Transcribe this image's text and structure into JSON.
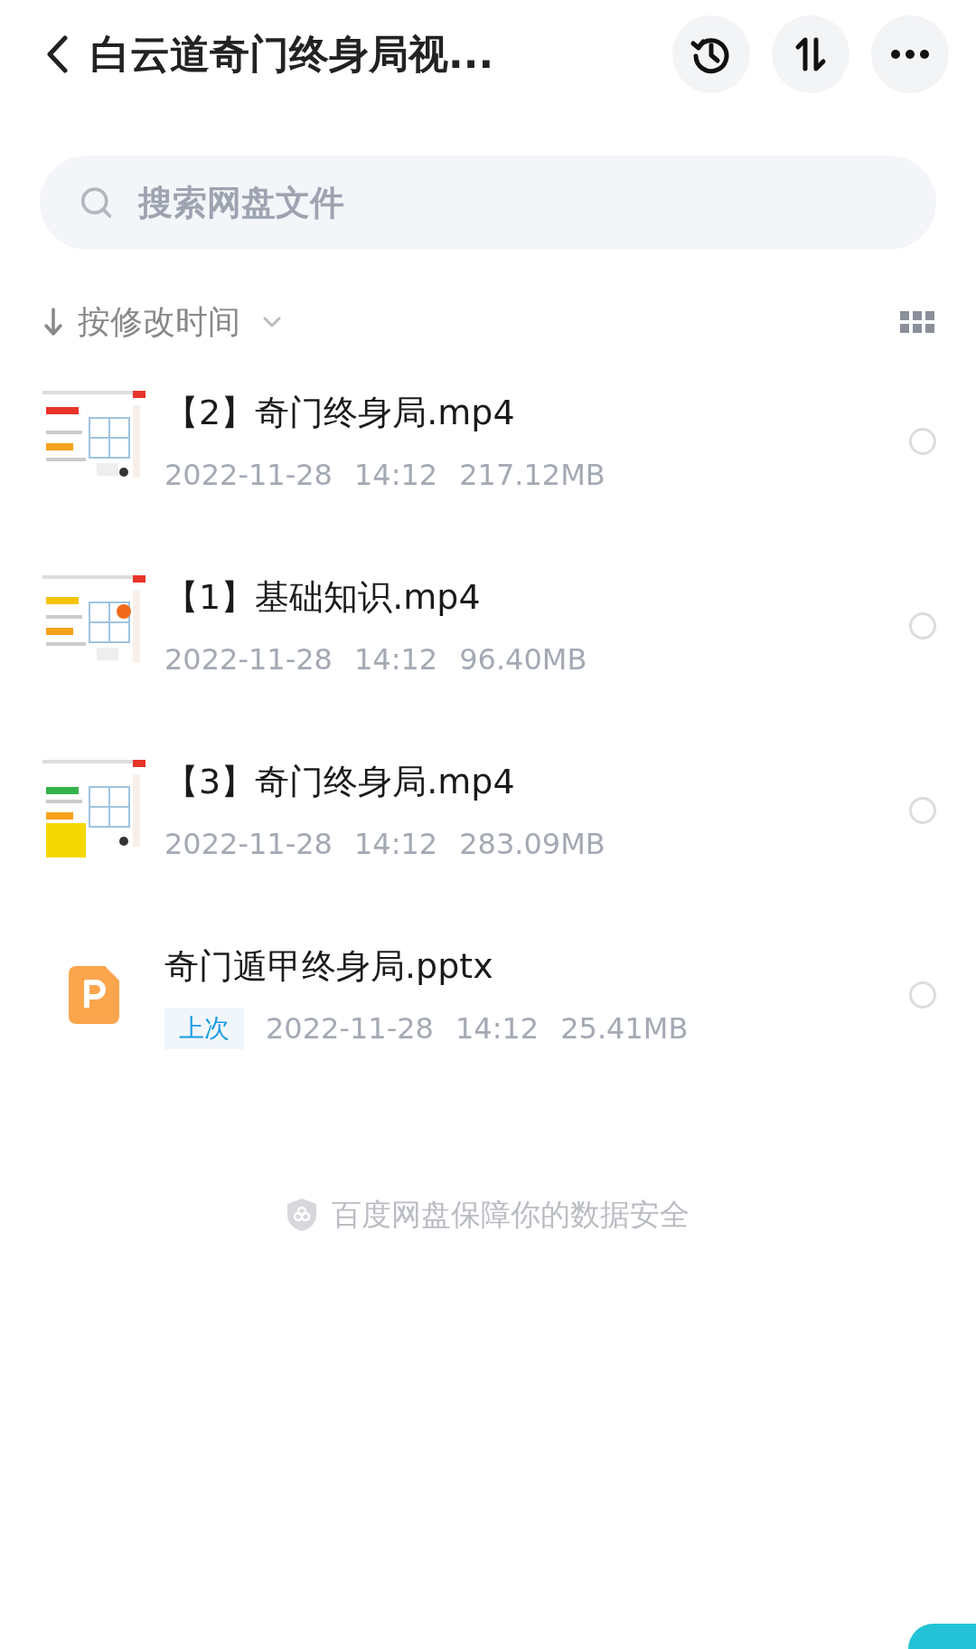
{
  "header": {
    "title": "白云道奇门终身局视..."
  },
  "search": {
    "placeholder": "搜索网盘文件"
  },
  "sort": {
    "label": "按修改时间"
  },
  "files": [
    {
      "kind": "video",
      "name": "【2】奇门终身局.mp4",
      "date": "2022-11-28",
      "time": "14:12",
      "size": "217.12MB",
      "selected": false
    },
    {
      "kind": "video",
      "name": "【1】基础知识.mp4",
      "date": "2022-11-28",
      "time": "14:12",
      "size": "96.40MB",
      "selected": false
    },
    {
      "kind": "video",
      "name": "【3】奇门终身局.mp4",
      "date": "2022-11-28",
      "time": "14:12",
      "size": "283.09MB",
      "selected": false
    },
    {
      "kind": "pptx",
      "name": "奇门遁甲终身局.pptx",
      "tag": "上次",
      "date": "2022-11-28",
      "time": "14:12",
      "size": "25.41MB",
      "selected": false
    }
  ],
  "footer": {
    "text": "百度网盘保障你的数据安全"
  }
}
